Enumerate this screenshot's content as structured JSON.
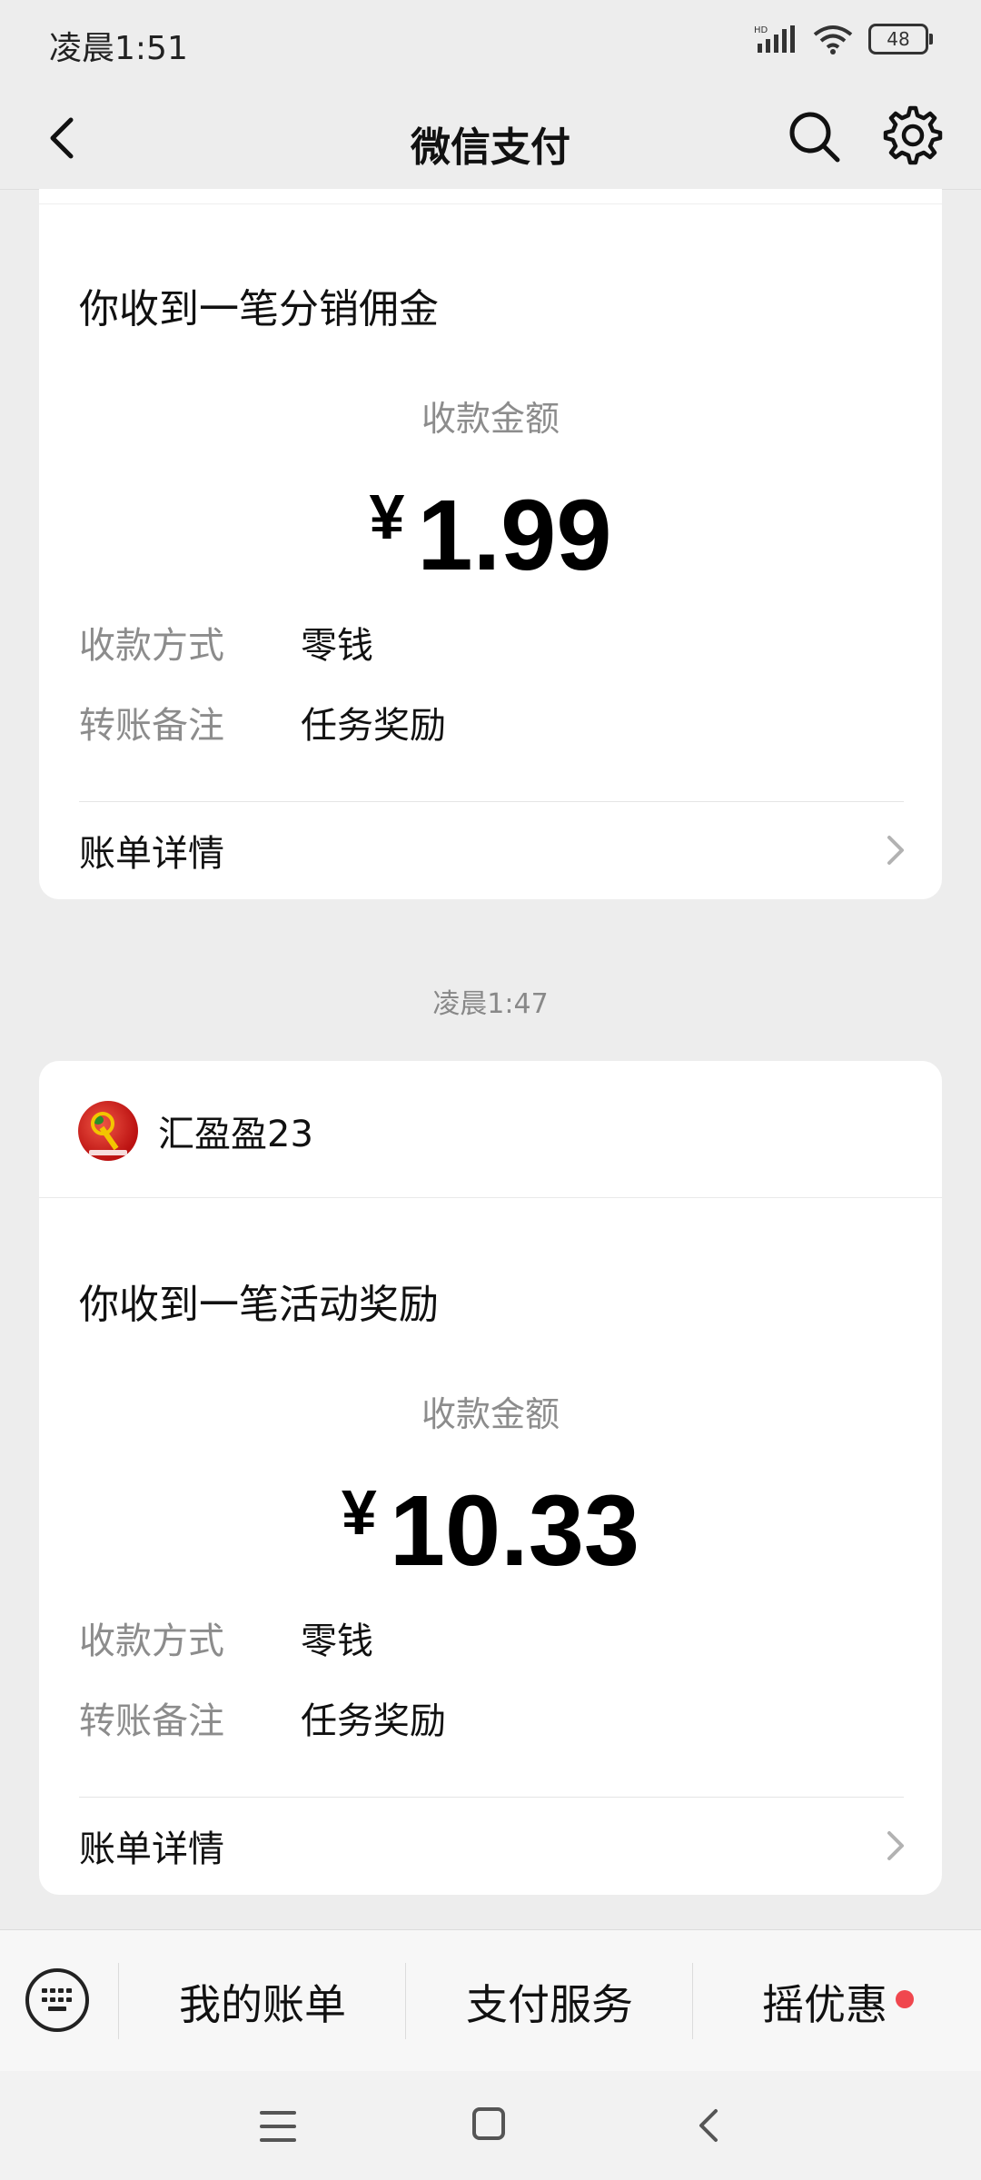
{
  "status_bar": {
    "time": "凌晨1:51",
    "battery": "48",
    "network": "HD"
  },
  "header": {
    "title": "微信支付"
  },
  "cards": [
    {
      "sender": null,
      "headline": "你收到一笔分销佣金",
      "amount_label": "收款金额",
      "currency": "¥",
      "amount": "1.99",
      "fields": [
        {
          "key": "收款方式",
          "value": "零钱"
        },
        {
          "key": "转账备注",
          "value": "任务奖励"
        }
      ],
      "bill_label": "账单详情"
    },
    {
      "sender": "汇盈盈23",
      "headline": "你收到一笔活动奖励",
      "amount_label": "收款金额",
      "currency": "¥",
      "amount": "10.33",
      "fields": [
        {
          "key": "收款方式",
          "value": "零钱"
        },
        {
          "key": "转账备注",
          "value": "任务奖励"
        }
      ],
      "bill_label": "账单详情"
    }
  ],
  "timestamp": "凌晨1:47",
  "bottom_menu": {
    "items": [
      "我的账单",
      "支付服务",
      "摇优惠"
    ]
  },
  "colors": {
    "accent_dot": "#f0474e",
    "background": "#ededed"
  },
  "icons": [
    "back-arrow-icon",
    "search-icon",
    "gear-icon",
    "keyboard-icon",
    "chevron-right-icon",
    "nav-menu-icon",
    "nav-home-icon",
    "nav-back-icon"
  ]
}
